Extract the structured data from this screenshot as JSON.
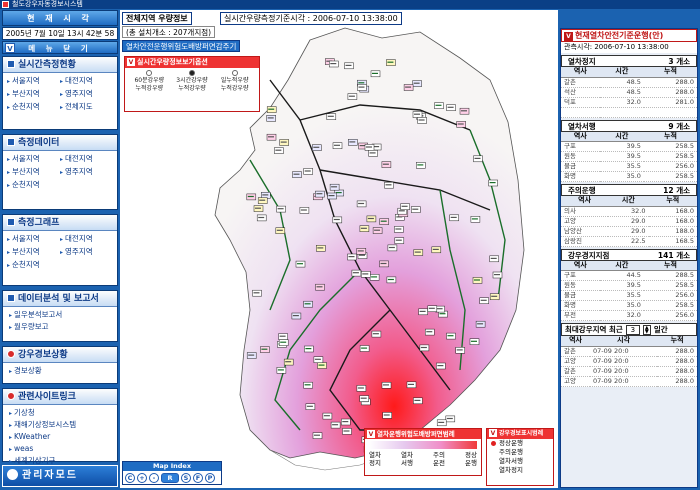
{
  "window": {
    "title": "철도강우자동경보시스템"
  },
  "left": {
    "clock_header": "현 재 시 각",
    "clock_value": "2005년 7월 10일 13시 42분 58초",
    "menu_header": "메 뉴 닫 기",
    "sections": [
      {
        "title": "실시간측정현황",
        "items": [
          "서울지역",
          "대전지역",
          "부산지역",
          "영주지역",
          "순천지역",
          "전체지도"
        ]
      },
      {
        "title": "측정데이터",
        "items": [
          "서울지역",
          "대전지역",
          "부산지역",
          "영주지역",
          "순천지역"
        ]
      },
      {
        "title": "측정그래프",
        "items": [
          "서울지역",
          "대전지역",
          "부산지역",
          "영주지역",
          "순천지역"
        ]
      },
      {
        "title": "데이터분석 및 보고서",
        "items": [
          "일우분석보고서",
          "월우량보고"
        ]
      },
      {
        "title": "강우경보상황",
        "items": [
          "경보상황"
        ]
      },
      {
        "title": "관련사이트링크",
        "items": [
          "기상청",
          "재해기상정보시스템",
          "KWeather",
          "weas",
          "세계기상기구"
        ]
      }
    ],
    "admin_mode": "관리자모드"
  },
  "center": {
    "region_title": "전체지역 우량정보",
    "measure_time": "실시간우량측정기준시각 : 2006-07-10 13:38:00",
    "install_count": "(총 설치개소 : 207개지점)",
    "train_button": "열차안전운행위험도배방퍼면감주기",
    "options_box": {
      "title": "실시간우량정보보기옵션",
      "options": [
        "60분강우량",
        "3시간강우량",
        "일누적우량",
        "누적강우량",
        "누적강우량",
        "누적강우량"
      ]
    },
    "legend": {
      "title": "열차운행위험도배방퍼면범례",
      "left_top": "열차",
      "mid_top": "열차",
      "right_top": "주의",
      "far_top": "정상",
      "left_bot": "정지",
      "mid_bot": "서행",
      "right_bot": "운전",
      "far_bot": "운행"
    },
    "map_index": {
      "title": "Map Index",
      "buttons": [
        "C",
        "+",
        "-",
        "R",
        "S",
        "F",
        "P"
      ]
    },
    "alarm": {
      "title": "강우경보표시범례",
      "rows": [
        {
          "label": "정상운행",
          "color": "#e02020"
        },
        {
          "label": "주의운행",
          "color": "#ffffff"
        },
        {
          "label": "열차서행",
          "color": "#ffffff"
        },
        {
          "label": "열차정지",
          "color": "#ffffff"
        }
      ]
    }
  },
  "right": {
    "header": "현재열차안전기준운행(안)",
    "issue_time": "관측시각: 2006-07-10 13:38:00",
    "sections": [
      {
        "title": "열차정지",
        "count": "3 개소",
        "columns": [
          "역사",
          "시간",
          "누적"
        ],
        "rows": [
          [
            "갈촌",
            "48.5",
            "288.0"
          ],
          [
            "석산",
            "48.5",
            "288.0"
          ],
          [
            "덕포",
            "32.0",
            "281.0"
          ]
        ]
      },
      {
        "title": "열차서행",
        "count": "9 개소",
        "columns": [
          "역사",
          "시간",
          "누적"
        ],
        "rows": [
          [
            "구포",
            "39.5",
            "258.5"
          ],
          [
            "원동",
            "39.5",
            "258.5"
          ],
          [
            "물금",
            "35.5",
            "256.0"
          ],
          [
            "화명",
            "35.0",
            "258.5"
          ]
        ]
      },
      {
        "title": "주의운행",
        "count": "12 개소",
        "columns": [
          "역사",
          "시간",
          "누적"
        ],
        "rows": [
          [
            "의사",
            "32.0",
            "168.0"
          ],
          [
            "고양",
            "29.0",
            "168.0"
          ],
          [
            "남양산",
            "29.0",
            "188.0"
          ],
          [
            "삼랑진",
            "22.5",
            "168.5"
          ]
        ]
      },
      {
        "title": "강우경지지점",
        "count": "141 개소",
        "columns": [
          "역사",
          "시간",
          "누적"
        ],
        "rows": [
          [
            "구포",
            "44.5",
            "288.5"
          ],
          [
            "원동",
            "39.5",
            "258.5"
          ],
          [
            "물금",
            "35.5",
            "256.0"
          ],
          [
            "화명",
            "35.0",
            "258.5"
          ],
          [
            "부전",
            "32.0",
            "256.0"
          ]
        ]
      }
    ],
    "recent": {
      "label": "최대강우지역 최근",
      "value": "3",
      "unit": "일간"
    },
    "recent_table": {
      "columns": [
        "역사",
        "시각",
        "누적"
      ],
      "rows": [
        [
          "갈촌",
          "07-09 20:0",
          "288.0"
        ],
        [
          "고양",
          "07-09 20:0",
          "288.0"
        ],
        [
          "갈촌",
          "07-09 20:0",
          "288.0"
        ],
        [
          "고양",
          "07-09 20:0",
          "288.0"
        ]
      ]
    }
  }
}
